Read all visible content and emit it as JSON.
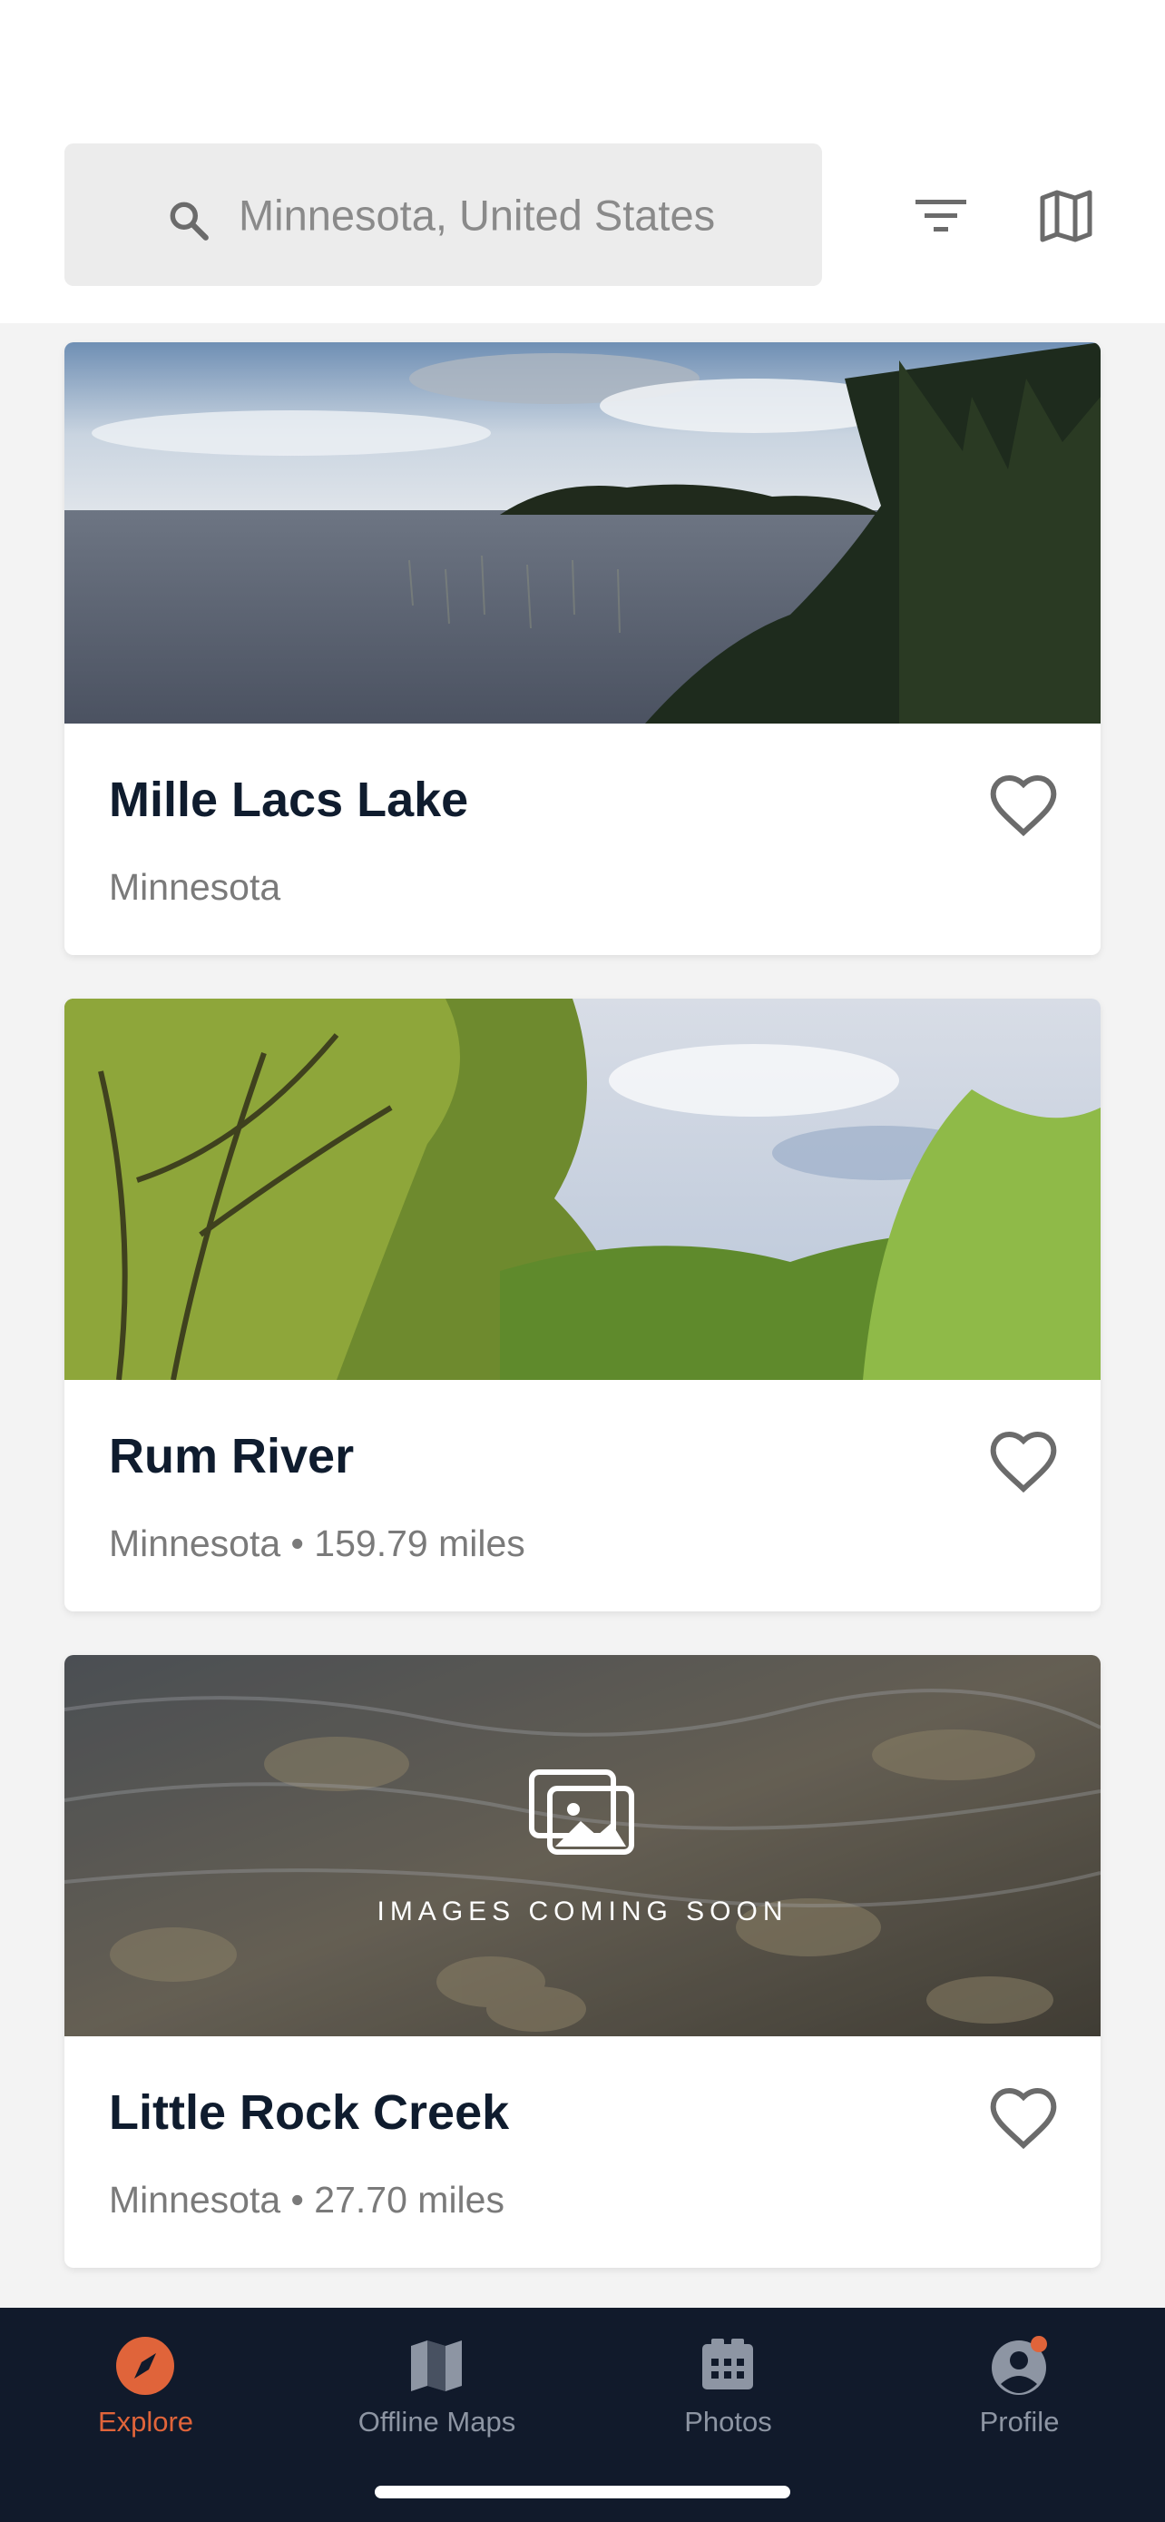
{
  "search": {
    "placeholder": "Minnesota, United States"
  },
  "header": {
    "filter_icon": "filter-icon",
    "map_icon": "map-icon"
  },
  "places": [
    {
      "name": "Mille Lacs Lake",
      "meta": "Minnesota"
    },
    {
      "name": "Rum River",
      "meta": "Minnesota • 159.79 miles"
    },
    {
      "name": "Little Rock Creek",
      "meta": "Minnesota • 27.70 miles",
      "image_placeholder": "IMAGES COMING SOON"
    }
  ],
  "tabs": [
    {
      "label": "Explore",
      "icon": "compass-icon",
      "active": true
    },
    {
      "label": "Offline Maps",
      "icon": "map-icon",
      "active": false
    },
    {
      "label": "Photos",
      "icon": "photos-icon",
      "active": false
    },
    {
      "label": "Profile",
      "icon": "profile-icon",
      "active": false,
      "badge": true
    }
  ],
  "colors": {
    "accent": "#e0643a",
    "tabbar": "#111a2b",
    "title": "#0f1c2e"
  }
}
